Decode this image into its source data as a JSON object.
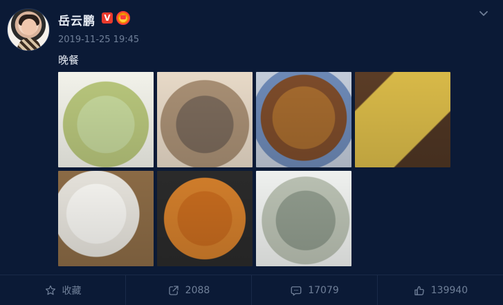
{
  "post": {
    "user_name": "岳云鹏",
    "badges": {
      "verified": "V",
      "crown_icon": "crown-icon"
    },
    "timestamp": "2019-11-25 19:45",
    "text": "晚餐",
    "images": [
      {
        "name": "food-photo-1"
      },
      {
        "name": "food-photo-2"
      },
      {
        "name": "food-photo-3"
      },
      {
        "name": "food-photo-4"
      },
      {
        "name": "food-photo-5"
      },
      {
        "name": "food-photo-6"
      },
      {
        "name": "food-photo-7"
      }
    ]
  },
  "actions": {
    "favorite": {
      "icon": "star-icon",
      "label": "收藏"
    },
    "repost": {
      "icon": "share-icon",
      "count": "2088"
    },
    "comment": {
      "icon": "comment-icon",
      "count": "17079"
    },
    "like": {
      "icon": "thumbs-up-icon",
      "count": "139940"
    }
  },
  "colors": {
    "background": "#0b1a36",
    "muted_text": "#6f7f98",
    "primary_text": "#e6ebf3",
    "divider": "#1a2a49"
  }
}
